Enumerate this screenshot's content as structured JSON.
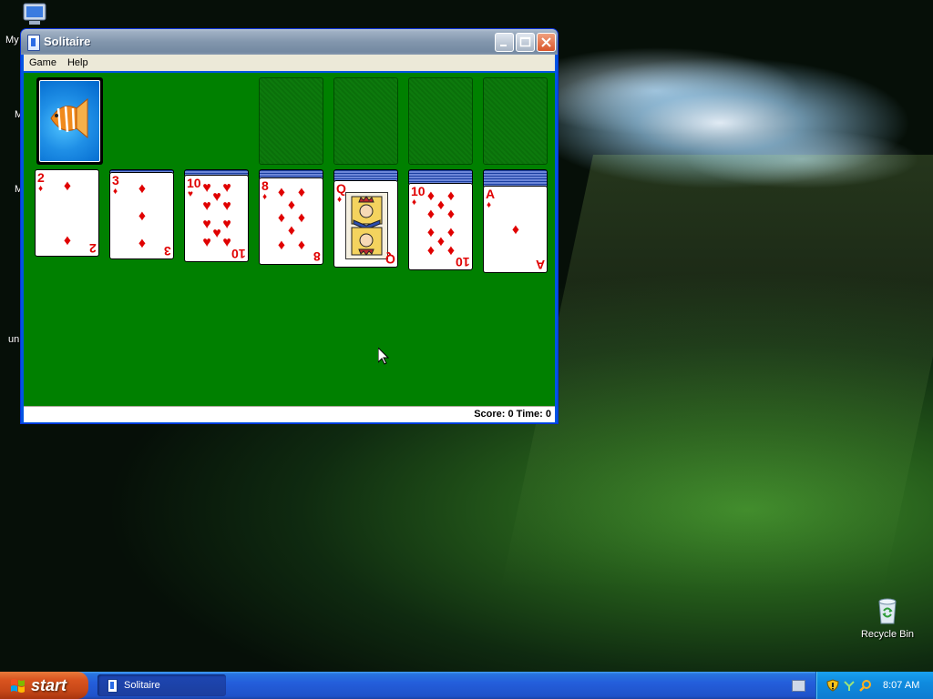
{
  "window": {
    "title": "Solitaire",
    "menu": [
      "Game",
      "Help"
    ],
    "status": "Score: 0 Time: 0"
  },
  "game": {
    "tableau": [
      {
        "rank": "2",
        "suit": "diamonds",
        "face_down": 0
      },
      {
        "rank": "3",
        "suit": "diamonds",
        "face_down": 1
      },
      {
        "rank": "10",
        "suit": "hearts",
        "face_down": 2
      },
      {
        "rank": "8",
        "suit": "diamonds",
        "face_down": 3
      },
      {
        "rank": "Q",
        "suit": "diamonds",
        "face_down": 4
      },
      {
        "rank": "10",
        "suit": "diamonds",
        "face_down": 5
      },
      {
        "rank": "A",
        "suit": "diamonds",
        "face_down": 6
      }
    ],
    "stock": "face-down deck (fish back)",
    "foundations_empty": 4,
    "colors": {
      "felt": "#008000",
      "red_suit": "#e00000"
    }
  },
  "desktop": {
    "icons": [
      {
        "label": "Recycle Bin",
        "icon": "recycle-bin-icon"
      }
    ],
    "partial_labels": [
      "My",
      "M",
      "M",
      "unl"
    ]
  },
  "taskbar": {
    "start_label": "start",
    "tasks": [
      {
        "label": "Solitaire",
        "icon": "solitaire-icon"
      }
    ],
    "clock": "8:07 AM"
  }
}
